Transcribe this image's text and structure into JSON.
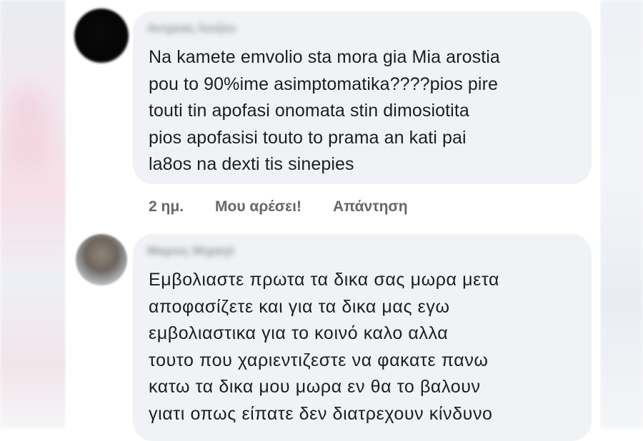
{
  "comments": [
    {
      "author": "Αντρεας Λοιζου",
      "text": "Na kamete emvolio sta mora gia Mia arostia\npou to 90%ime asimptomatika????pios pire\ntouti tin apofasi onomata stin dimosiotita\npios apofasisi touto to prama an kati pai\nla8os na dexti tis sinepies",
      "time": "2 ημ.",
      "like_label": "Μου αρέσει!",
      "reply_label": "Απάντηση"
    },
    {
      "author": "Μαριος Μιχαηλ",
      "text": "Εμβολιαστε πρωτα τα δικα σας μωρα μετα\nαποφασίζετε και για τα δικα μας εγω\nεμβολιαστικα για το κοινό καλο αλλα\nτουτο που χαριεντιζεστε να φακατε πανω\nκατω τα δικα μου μωρα εν θα το βαλουν\nγιατι οπως είπατε δεν διατρεχουν κίνδυνο"
    }
  ],
  "colors": {
    "bubble": "#f0f2f5",
    "text": "#1c1e21",
    "meta": "#65676b"
  }
}
